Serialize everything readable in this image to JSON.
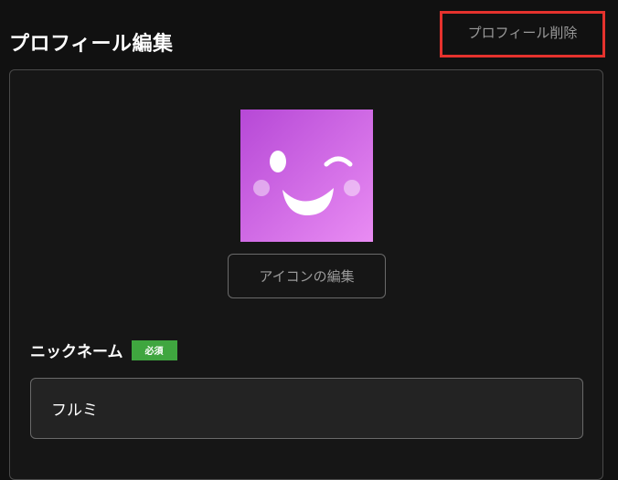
{
  "header": {
    "title": "プロフィール編集",
    "delete_label": "プロフィール削除"
  },
  "profile": {
    "avatar_icon": "winking-smile-face",
    "edit_icon_label": "アイコンの編集"
  },
  "nickname_field": {
    "label": "ニックネーム",
    "required_badge": "必須",
    "value": "フルミ"
  },
  "colors": {
    "background": "#111111",
    "highlight_border": "#e5322d",
    "required_badge": "#3fa63f",
    "avatar_gradient_start": "#b648d6",
    "avatar_gradient_end": "#e98cf3"
  }
}
